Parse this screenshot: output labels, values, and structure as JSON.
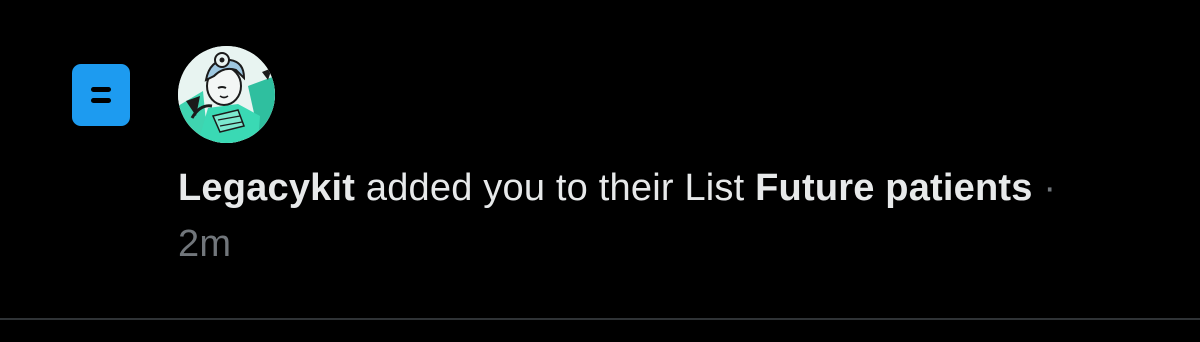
{
  "notification": {
    "type_icon": "list-icon",
    "avatar_icon": "user-avatar",
    "actor": "Legacykit",
    "action_text": " added you to their List ",
    "list_name": "Future patients",
    "separator": " · ",
    "time": "2m"
  },
  "colors": {
    "background": "#000000",
    "accent": "#1d9bf0",
    "text": "#e7e9ea",
    "muted": "#71767b",
    "divider": "#2f3336"
  }
}
